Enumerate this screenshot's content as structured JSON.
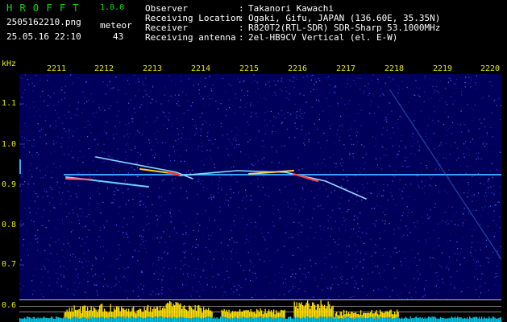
{
  "header": {
    "app_title": "H R O F F T",
    "app_version": "1.0.0",
    "filename": "2505162210.png",
    "datetime": "25.05.16 22:10",
    "meteor_label": "meteor",
    "meteor_count": "43",
    "fields": [
      {
        "label": "Observer",
        "sep": ":",
        "value": "Takanori Kawachi"
      },
      {
        "label": "Receiving Location",
        "sep": ":",
        "value": "Ogaki, Gifu, JAPAN (136.60E, 35.35N)"
      },
      {
        "label": "Receiver",
        "sep": ":",
        "value": "R820T2(RTL-SDR) SDR-Sharp 53.1000MHz"
      },
      {
        "label": "Receiving antenna",
        "sep": ":",
        "value": "2el-HB9CV Vertical (el. E-W)"
      }
    ]
  },
  "axis": {
    "y_unit": "kHz",
    "y_ticks": [
      "1.1",
      "1.0",
      "0.9",
      "0.8",
      "0.7",
      "0.6"
    ],
    "x_ticks": [
      "2211",
      "2212",
      "2213",
      "2214",
      "2215",
      "2216",
      "2217",
      "2218",
      "2219",
      "2220"
    ]
  },
  "colors": {
    "background": "#000000",
    "noise_base": "#00005a",
    "carrier": "#3aa0ff",
    "strip": "#00c8e8",
    "peaks": "#ffe000",
    "labels": "#f0f000"
  }
}
